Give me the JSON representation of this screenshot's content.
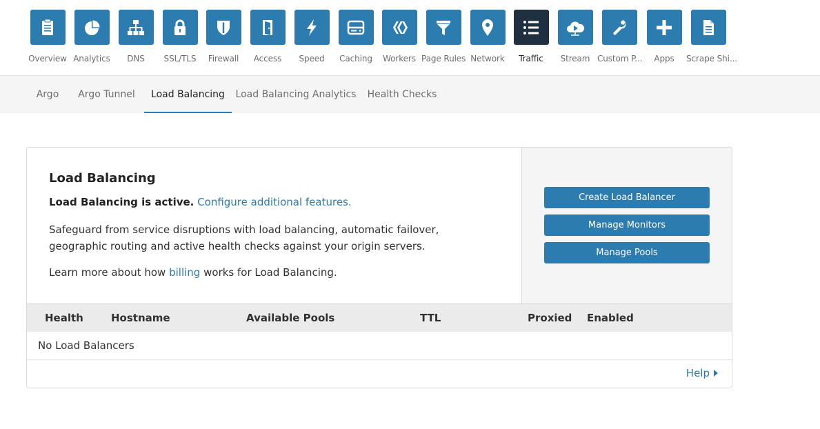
{
  "apps": [
    {
      "label": "Overview",
      "icon": "clipboard-icon"
    },
    {
      "label": "Analytics",
      "icon": "pie-chart-icon"
    },
    {
      "label": "DNS",
      "icon": "sitemap-icon"
    },
    {
      "label": "SSL/TLS",
      "icon": "lock-icon"
    },
    {
      "label": "Firewall",
      "icon": "shield-icon"
    },
    {
      "label": "Access",
      "icon": "door-icon"
    },
    {
      "label": "Speed",
      "icon": "lightning-icon"
    },
    {
      "label": "Caching",
      "icon": "server-icon"
    },
    {
      "label": "Workers",
      "icon": "workers-icon"
    },
    {
      "label": "Page Rules",
      "icon": "filter-icon"
    },
    {
      "label": "Network",
      "icon": "location-pin-icon"
    },
    {
      "label": "Traffic",
      "icon": "list-icon",
      "active": true
    },
    {
      "label": "Stream",
      "icon": "cloud-play-icon"
    },
    {
      "label": "Custom P...",
      "icon": "wrench-icon"
    },
    {
      "label": "Apps",
      "icon": "plus-icon"
    },
    {
      "label": "Scrape Shi...",
      "icon": "document-icon"
    }
  ],
  "subtabs": [
    {
      "label": "Argo"
    },
    {
      "label": "Argo Tunnel"
    },
    {
      "label": "Load Balancing",
      "active": true
    },
    {
      "label": "Load Balancing Analytics"
    },
    {
      "label": "Health Checks"
    }
  ],
  "card": {
    "title": "Load Balancing",
    "status_bold": "Load Balancing is active.",
    "status_link": "Configure additional features.",
    "description": "Safeguard from service disruptions with load balancing, automatic failover, geographic routing and active health checks against your origin servers.",
    "learn_prefix": "Learn more about how",
    "learn_link": "billing",
    "learn_suffix": "works for Load Balancing.",
    "buttons": {
      "create": "Create Load Balancer",
      "monitors": "Manage Monitors",
      "pools": "Manage Pools"
    },
    "table": {
      "columns": [
        "Health",
        "Hostname",
        "Available Pools",
        "TTL",
        "Proxied",
        "Enabled"
      ],
      "empty_text": "No Load Balancers"
    },
    "help": "Help"
  },
  "colors": {
    "accent": "#2c7cb0",
    "active_tile": "#1f3040"
  }
}
